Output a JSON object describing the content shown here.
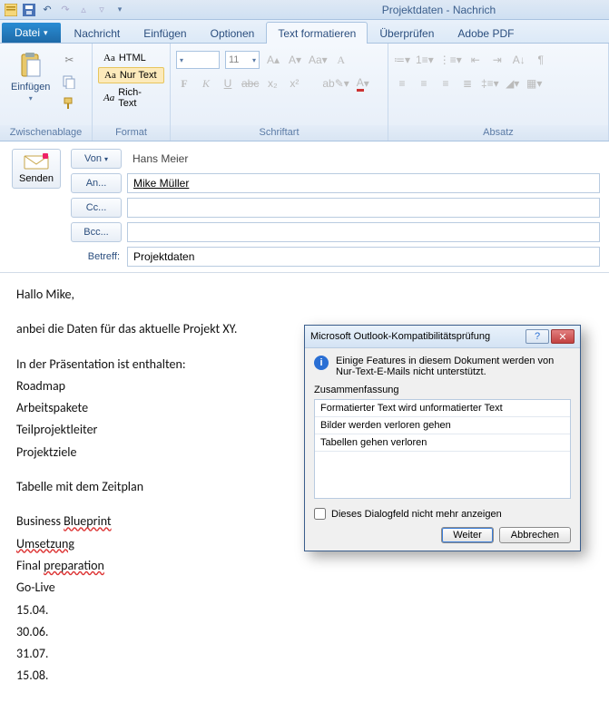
{
  "titlebar": {
    "app_title": "Projektdaten   -   Nachrich"
  },
  "tabs": {
    "file": "Datei",
    "items": [
      {
        "label": "Nachricht"
      },
      {
        "label": "Einfügen"
      },
      {
        "label": "Optionen"
      },
      {
        "label": "Text formatieren"
      },
      {
        "label": "Überprüfen"
      },
      {
        "label": "Adobe PDF"
      }
    ],
    "active_index": 3
  },
  "ribbon": {
    "clipboard": {
      "title": "Zwischenablage",
      "paste": "Einfügen"
    },
    "format": {
      "title": "Format",
      "html": "HTML",
      "plain": "Nur Text",
      "rich": "Rich-Text"
    },
    "font": {
      "title": "Schriftart",
      "size": "11"
    },
    "paragraph": {
      "title": "Absatz"
    }
  },
  "envelope": {
    "send": "Senden",
    "from_btn": "Von",
    "from_value": "Hans Meier",
    "to_btn": "An...",
    "to_value": "Mike Müller",
    "cc_btn": "Cc...",
    "cc_value": "",
    "bcc_btn": "Bcc...",
    "bcc_value": "",
    "subject_label": "Betreff:",
    "subject_value": "Projektdaten"
  },
  "body": {
    "l1": "Hallo Mike,",
    "l2": "anbei die Daten für das aktuelle Projekt XY.",
    "l3": "In der Präsentation ist enthalten:",
    "l4": "Roadmap",
    "l5": "Arbeitspakete",
    "l6": "Teilprojektleiter",
    "l7": "Projektziele",
    "l8": "Tabelle mit dem Zeitplan",
    "l9a": "Business ",
    "l9b": "Blueprint",
    "l10": "Umsetzung",
    "l11a": "Final ",
    "l11b": "preparation",
    "l12": "Go-Live",
    "l13": "15.04.",
    "l14": "30.06.",
    "l15": "31.07.",
    "l16": "15.08."
  },
  "dialog": {
    "title": "Microsoft Outlook-Kompatibilitätsprüfung",
    "info": "Einige Features in diesem Dokument werden von Nur-Text-E-Mails nicht unterstützt.",
    "summary_label": "Zusammenfassung",
    "items": [
      "Formatierter Text wird unformatierter Text",
      "Bilder werden verloren gehen",
      "Tabellen gehen verloren"
    ],
    "checkbox": "Dieses Dialogfeld nicht mehr anzeigen",
    "continue": "Weiter",
    "cancel": "Abbrechen"
  }
}
